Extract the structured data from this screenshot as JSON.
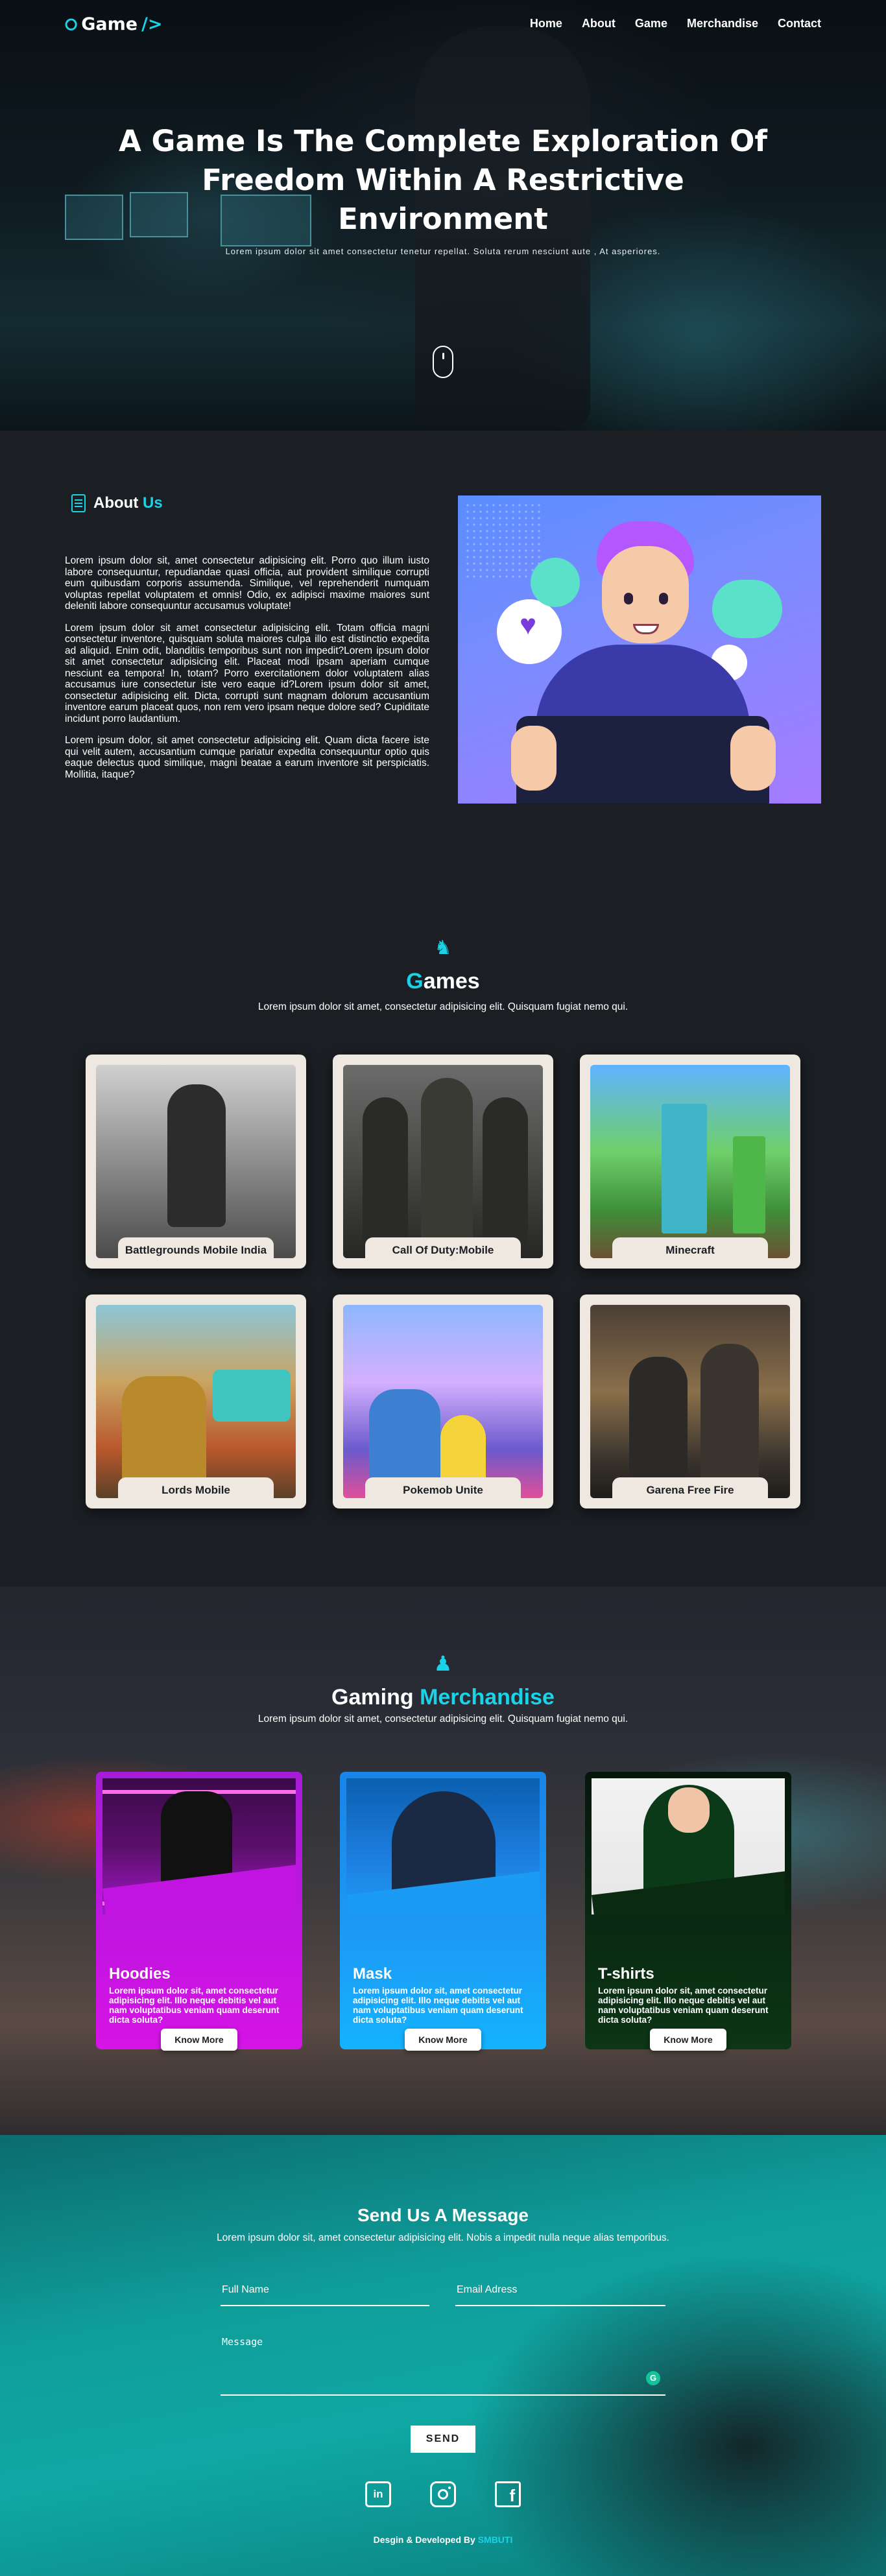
{
  "nav": {
    "logo_text": "Game",
    "logo_suffix": "/>",
    "links": [
      "Home",
      "About",
      "Game",
      "Merchandise",
      "Contact"
    ]
  },
  "hero": {
    "title": "A Game Is The Complete Exploration Of Freedom Within A Restrictive Environment",
    "subtitle": "Lorem ipsum dolor sit amet consectetur tenetur repellat. Soluta rerum nesciunt aute , At asperiores."
  },
  "about": {
    "title_plain": "About",
    "title_accent": "Us",
    "paragraphs": [
      "Lorem ipsum dolor sit, amet consectetur adipisicing elit. Porro quo illum iusto labore consequuntur, repudiandae quasi officia, aut provident similique corrupti eum quibusdam corporis assumenda. Similique, vel reprehenderit numquam voluptas repellat voluptatem et omnis! Odio, ex adipisci maxime maiores sunt deleniti labore consequuntur accusamus voluptate!",
      "Lorem ipsum dolor sit amet consectetur adipisicing elit. Totam officia magni consectetur inventore, quisquam soluta maiores culpa illo est distinctio expedita ad aliquid. Enim odit, blanditiis temporibus sunt non impedit?Lorem ipsum dolor sit amet consectetur adipisicing elit. Placeat modi ipsam aperiam cumque nesciunt ea tempora! In, totam? Porro exercitationem dolor voluptatem alias accusamus iure consectetur iste vero eaque id?Lorem ipsum dolor sit amet, consectetur adipisicing elit. Dicta, corrupti sunt magnam dolorum accusantium inventore earum placeat quos, non rem vero ipsam neque dolore sed? Cupiditate incidunt porro laudantium.",
      "Lorem ipsum dolor, sit amet consectetur adipisicing elit. Quam dicta facere iste qui velit autem, accusantium cumque pariatur expedita consequuntur optio quis eaque delectus quod similique, magni beatae a earum inventore sit perspiciatis. Mollitia, itaque?"
    ]
  },
  "games": {
    "title_first_letter": "G",
    "title_rest": "ames",
    "description": "Lorem ipsum dolor sit amet, consectetur adipisicing elit. Quisquam fugiat nemo qui.",
    "items": [
      {
        "name": "Battlegrounds Mobile India"
      },
      {
        "name": "Call Of Duty:Mobile"
      },
      {
        "name": "Minecraft"
      },
      {
        "name": "Lords Mobile"
      },
      {
        "name": "Pokemob Unite"
      },
      {
        "name": "Garena Free Fire"
      }
    ]
  },
  "merch": {
    "title_plain": "Gaming",
    "title_accent": "Merchandise",
    "description": "Lorem ipsum dolor sit amet, consectetur adipisicing elit. Quisquam fugiat nemo qui.",
    "items": [
      {
        "title": "Hoodies",
        "text": "Lorem ipsum dolor sit, amet consectetur adipisicing elit. Illo neque debitis vel aut nam voluptatibus veniam quam deserunt dicta soluta?",
        "button": "Know More"
      },
      {
        "title": "Mask",
        "text": "Lorem ipsum dolor sit, amet consectetur adipisicing elit. Illo neque debitis vel aut nam voluptatibus veniam quam deserunt dicta soluta?",
        "button": "Know More"
      },
      {
        "title": "T-shirts",
        "text": "Lorem ipsum dolor sit, amet consectetur adipisicing elit. Illo neque debitis vel aut nam voluptatibus veniam quam deserunt dicta soluta?",
        "button": "Know More"
      }
    ]
  },
  "contact": {
    "title": "Send Us A Message",
    "description": "Lorem ipsum dolor sit, amet consectetur adipisicing elit. Nobis a impedit nulla neque alias temporibus.",
    "name_placeholder": "Full Name",
    "email_placeholder": "Email Adress",
    "message_placeholder": "Message",
    "send_label": "SEND",
    "socials": [
      "linkedin-icon",
      "instagram-icon",
      "facebook-icon"
    ],
    "credit_prefix": "Desgin & Developed By",
    "credit_name": "SMBUTI"
  },
  "colors": {
    "accent": "#19d3e6",
    "background": "#1b1e22",
    "hoodie_card": "#c214e0",
    "mask_card": "#1c9bf4",
    "tshirt_card": "#0a2a12"
  }
}
